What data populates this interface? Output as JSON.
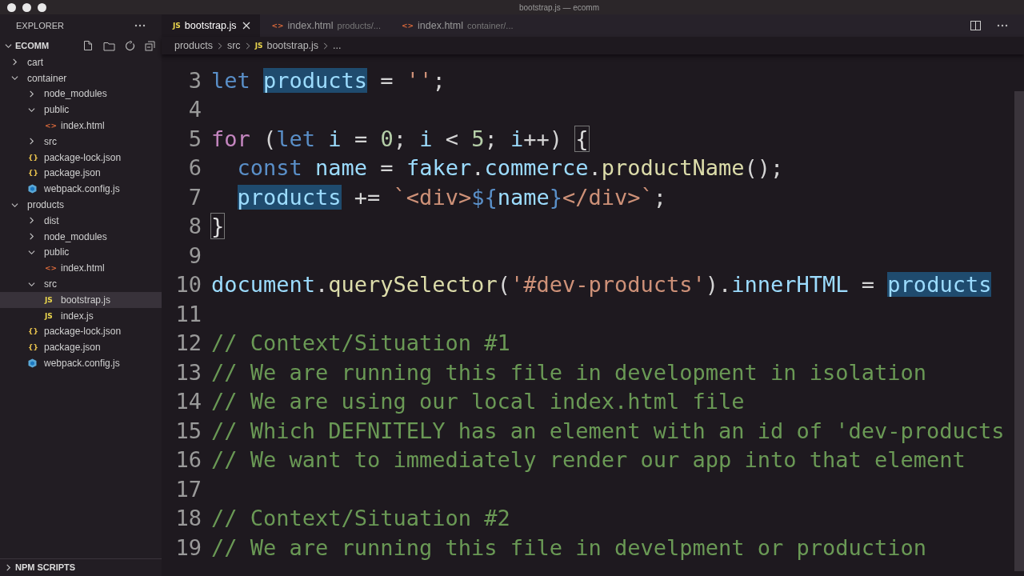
{
  "window": {
    "title": "bootstrap.js — ecomm"
  },
  "sidebar": {
    "title": "EXPLORER",
    "section": {
      "label": "ECOMM",
      "expanded": true
    },
    "tree": [
      {
        "name": "cart",
        "kind": "folder",
        "expanded": false,
        "selected": false
      },
      {
        "name": "container",
        "kind": "folder",
        "expanded": true,
        "selected": false,
        "children": [
          {
            "name": "node_modules",
            "kind": "folder",
            "expanded": false,
            "selected": false
          },
          {
            "name": "public",
            "kind": "folder",
            "expanded": true,
            "selected": false,
            "children": [
              {
                "name": "index.html",
                "kind": "html",
                "icon": "<>",
                "selected": false
              }
            ]
          },
          {
            "name": "src",
            "kind": "folder",
            "expanded": false,
            "selected": false
          },
          {
            "name": "package-lock.json",
            "kind": "json",
            "icon": "{}",
            "selected": false
          },
          {
            "name": "package.json",
            "kind": "json",
            "icon": "{}",
            "selected": false
          },
          {
            "name": "webpack.config.js",
            "kind": "webpack",
            "selected": false
          }
        ]
      },
      {
        "name": "products",
        "kind": "folder",
        "expanded": true,
        "selected": false,
        "children": [
          {
            "name": "dist",
            "kind": "folder",
            "expanded": false,
            "selected": false
          },
          {
            "name": "node_modules",
            "kind": "folder",
            "expanded": false,
            "selected": false
          },
          {
            "name": "public",
            "kind": "folder",
            "expanded": true,
            "selected": false,
            "children": [
              {
                "name": "index.html",
                "kind": "html",
                "icon": "<>",
                "selected": false
              }
            ]
          },
          {
            "name": "src",
            "kind": "folder",
            "expanded": true,
            "selected": false,
            "children": [
              {
                "name": "bootstrap.js",
                "kind": "js",
                "icon": "JS",
                "selected": true
              },
              {
                "name": "index.js",
                "kind": "js",
                "icon": "JS",
                "selected": false
              }
            ]
          },
          {
            "name": "package-lock.json",
            "kind": "json",
            "icon": "{}",
            "selected": false
          },
          {
            "name": "package.json",
            "kind": "json",
            "icon": "{}",
            "selected": false
          },
          {
            "name": "webpack.config.js",
            "kind": "webpack",
            "selected": false
          }
        ]
      }
    ],
    "bottom_section": {
      "label": "NPM SCRIPTS",
      "expanded": false
    }
  },
  "tabs": [
    {
      "label": "bootstrap.js",
      "kind": "js",
      "icon": "JS",
      "selected": true
    },
    {
      "label": "index.html",
      "description": "products/...",
      "kind": "html",
      "icon": "<>",
      "selected": false
    },
    {
      "label": "index.html",
      "description": "container/...",
      "kind": "html",
      "icon": "<>",
      "selected": false
    }
  ],
  "breadcrumbs": [
    {
      "label": "products"
    },
    {
      "label": "src"
    },
    {
      "label": "bootstrap.js",
      "kind": "js",
      "icon": "JS"
    },
    {
      "label": "..."
    }
  ],
  "code_lines": [
    {
      "number": "3",
      "tokens": [
        {
          "text": "let ",
          "kind": "keyword"
        },
        {
          "text": "products",
          "kind": "match"
        },
        {
          "text": " = ",
          "kind": "plain"
        },
        {
          "text": "''",
          "kind": "string"
        },
        {
          "text": ";",
          "kind": "plain"
        }
      ]
    },
    {
      "number": "4"
    },
    {
      "number": "5",
      "tokens": [
        {
          "text": "for",
          "kind": "control"
        },
        {
          "text": " (",
          "kind": "plain"
        },
        {
          "text": "let ",
          "kind": "keyword"
        },
        {
          "text": "i",
          "kind": "variable"
        },
        {
          "text": " = ",
          "kind": "plain"
        },
        {
          "text": "0",
          "kind": "number"
        },
        {
          "text": "; ",
          "kind": "plain"
        },
        {
          "text": "i",
          "kind": "variable"
        },
        {
          "text": " < ",
          "kind": "plain"
        },
        {
          "text": "5",
          "kind": "number"
        },
        {
          "text": "; ",
          "kind": "plain"
        },
        {
          "text": "i",
          "kind": "variable"
        },
        {
          "text": "++) ",
          "kind": "plain"
        },
        {
          "text": "{",
          "kind": "bracket"
        }
      ]
    },
    {
      "number": "6",
      "tokens": [
        {
          "text": "  const ",
          "kind": "keyword"
        },
        {
          "text": "name",
          "kind": "variable"
        },
        {
          "text": " = ",
          "kind": "plain"
        },
        {
          "text": "faker",
          "kind": "variable"
        },
        {
          "text": ".",
          "kind": "plain"
        },
        {
          "text": "commerce",
          "kind": "variable"
        },
        {
          "text": ".",
          "kind": "plain"
        },
        {
          "text": "productName",
          "kind": "function"
        },
        {
          "text": "();",
          "kind": "plain"
        }
      ]
    },
    {
      "number": "7",
      "tokens": [
        {
          "text": "  products",
          "kind": "match"
        },
        {
          "text": " += ",
          "kind": "plain"
        },
        {
          "text": "`<div>",
          "kind": "string"
        },
        {
          "text": "${",
          "kind": "keyword"
        },
        {
          "text": "name",
          "kind": "variable"
        },
        {
          "text": "}",
          "kind": "keyword"
        },
        {
          "text": "</div>`",
          "kind": "string"
        },
        {
          "text": ";",
          "kind": "plain"
        }
      ]
    },
    {
      "number": "8",
      "tokens": [
        {
          "text": "}",
          "kind": "bracket"
        }
      ]
    },
    {
      "number": "9"
    },
    {
      "number": "10",
      "tokens": [
        {
          "text": "document",
          "kind": "variable"
        },
        {
          "text": ".",
          "kind": "plain"
        },
        {
          "text": "querySelector",
          "kind": "function"
        },
        {
          "text": "(",
          "kind": "plain"
        },
        {
          "text": "'#dev-products'",
          "kind": "string"
        },
        {
          "text": ").",
          "kind": "plain"
        },
        {
          "text": "innerHTML",
          "kind": "variable"
        },
        {
          "text": " = ",
          "kind": "plain"
        },
        {
          "text": "products",
          "kind": "match"
        }
      ]
    },
    {
      "number": "11"
    },
    {
      "number": "12",
      "tokens": [
        {
          "text": "// Context/Situation #1",
          "kind": "comment"
        }
      ]
    },
    {
      "number": "13",
      "tokens": [
        {
          "text": "// We are running this file in development in isolation",
          "kind": "comment"
        }
      ]
    },
    {
      "number": "14",
      "tokens": [
        {
          "text": "// We are using our local index.html file",
          "kind": "comment"
        }
      ]
    },
    {
      "number": "15",
      "tokens": [
        {
          "text": "// Which DEFNITELY has an element with an id of 'dev-products",
          "kind": "comment"
        }
      ]
    },
    {
      "number": "16",
      "tokens": [
        {
          "text": "// We want to immediately render our app into that element",
          "kind": "comment"
        }
      ]
    },
    {
      "number": "17"
    },
    {
      "number": "18",
      "tokens": [
        {
          "text": "// Context/Situation #2",
          "kind": "comment"
        }
      ]
    },
    {
      "number": "19",
      "tokens": [
        {
          "text": "// We are running this file in develpment or production",
          "kind": "comment"
        }
      ]
    }
  ]
}
